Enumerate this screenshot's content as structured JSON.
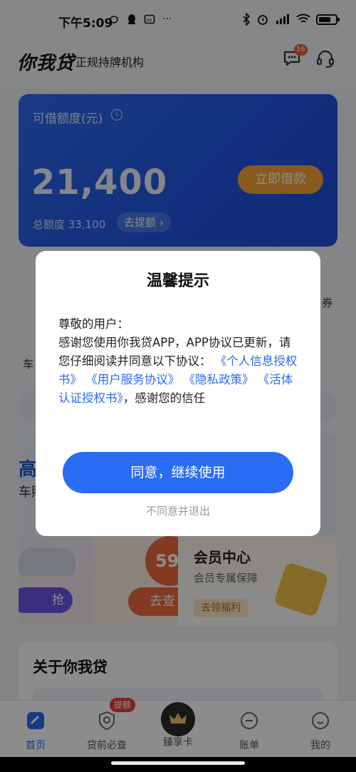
{
  "status_bar": {
    "time": "下午5:09",
    "left_icons": [
      "weibo-icon",
      "qq-icon",
      "app-icon",
      "more-icon"
    ],
    "right_icons": [
      "bluetooth-icon",
      "alarm-icon",
      "signal-icon",
      "wifi-icon",
      "battery-icon"
    ],
    "more_glyph": "···"
  },
  "header": {
    "logo": "你我贷",
    "subtitle": "正规持牌机构",
    "message_badge": "16"
  },
  "credit_card": {
    "label": "可借额度(元)",
    "amount": "21,400",
    "borrow_button": "立即借款",
    "total_label": "总额度 33,100",
    "raise_button": "去提额 ›"
  },
  "background": {
    "side_right_fragment": "券",
    "side_left_fragment": "车",
    "panel_left_big": "高1(",
    "panel_left_sub": "车照",
    "panel_left_pill": "抢",
    "panel_mid_circle": "59",
    "panel_mid_pill": "去查",
    "member_title": "会员中心",
    "member_sub": "会员专属保障",
    "member_tag": "去领福利",
    "about_title": "关于你我贷"
  },
  "dialog": {
    "title": "温馨提示",
    "greeting": "尊敬的用户：",
    "text_before": "感谢您使用你我贷APP，APP协议已更新，请您仔细阅读并同意以下协议：",
    "links": [
      "《个人信息授权书》",
      "《用户服务协议》",
      "《隐私政策》",
      "《活体认证授权书》"
    ],
    "text_after": "，感谢您的信任",
    "agree_button": "同意，继续使用",
    "decline_link": "不同意并退出"
  },
  "bottom_nav": {
    "items": [
      {
        "label": "首页",
        "icon": "home-icon",
        "active": true
      },
      {
        "label": "贷前必查",
        "icon": "search-shield-icon",
        "active": false
      },
      {
        "label": "臻享卡",
        "icon": "crown-icon",
        "active": false
      },
      {
        "label": "账单",
        "icon": "bill-icon",
        "active": false
      },
      {
        "label": "我的",
        "icon": "profile-icon",
        "active": false
      }
    ],
    "badge": "提额"
  },
  "colors": {
    "primary": "#2a6cf3",
    "card_blue": "#2157e4",
    "borrow_orange": "#f7a53a",
    "badge_red": "#ec3b3b"
  }
}
